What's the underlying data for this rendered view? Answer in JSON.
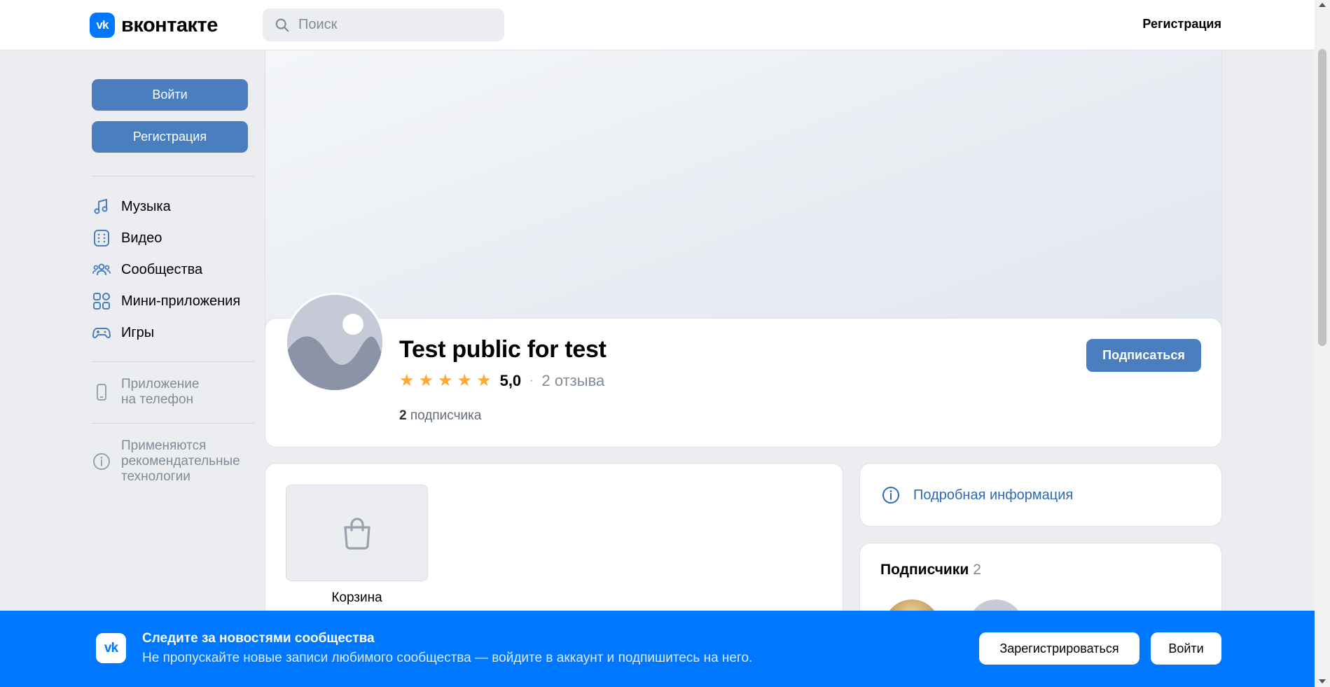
{
  "header": {
    "logo_mark": "vk",
    "logo_text": "вконтакте",
    "search_placeholder": "Поиск",
    "register_link": "Регистрация"
  },
  "sidebar": {
    "login_button": "Войти",
    "register_button": "Регистрация",
    "menu": [
      {
        "label": "Музыка",
        "icon": "music-icon"
      },
      {
        "label": "Видео",
        "icon": "video-icon"
      },
      {
        "label": "Сообщества",
        "icon": "communities-icon"
      },
      {
        "label": "Мини-приложения",
        "icon": "mini-apps-icon"
      },
      {
        "label": "Игры",
        "icon": "games-icon"
      }
    ],
    "app_line1": "Приложение",
    "app_line2": "на телефон",
    "rec_line1": "Применяются",
    "rec_line2": "рекомендательные",
    "rec_line3": "технологии"
  },
  "group": {
    "title": "Test public for test",
    "rating": "5,0",
    "stars": 5,
    "reviews": "2 отзыва",
    "followers_count": "2",
    "followers_label": "подписчика",
    "subscribe_button": "Подписаться"
  },
  "shop": {
    "cart_label": "Корзина"
  },
  "info": {
    "details_link": "Подробная информация"
  },
  "subscribers": {
    "title": "Подписчики",
    "count": "2"
  },
  "banner": {
    "logo_mark": "vk",
    "title": "Следите за новостями сообщества",
    "subtitle": "Не пропускайте новые записи любимого сообщества — войдите в аккаунт и подпишитесь на него.",
    "register_button": "Зарегистрироваться",
    "login_button": "Войти"
  },
  "colors": {
    "brand": "#0077ff",
    "primary_button": "#4a7ebf",
    "link": "#2d6ab3",
    "star": "#ffa832",
    "page_bg": "#ebedf0"
  }
}
